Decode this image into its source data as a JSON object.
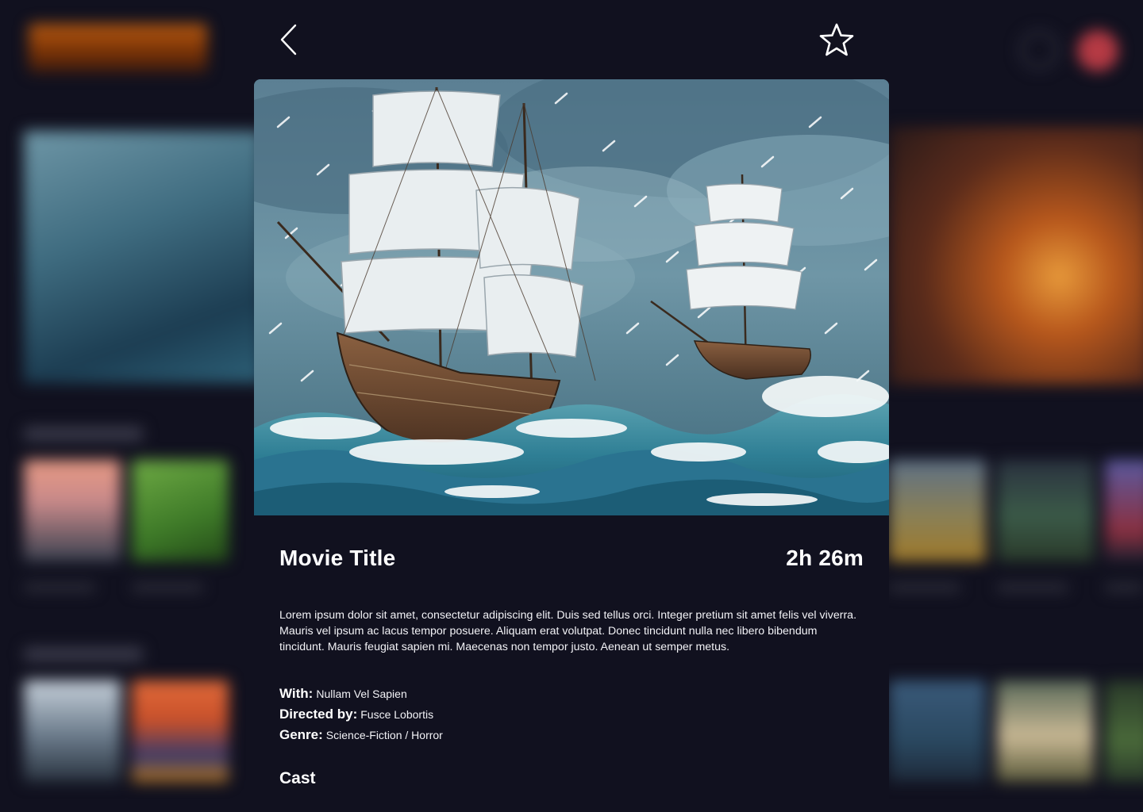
{
  "modal": {
    "title": "Movie Title",
    "runtime": "2h 26m",
    "description": "Lorem ipsum dolor sit amet, consectetur adipiscing elit. Duis sed tellus  orci. Integer pretium sit amet felis vel viverra. Mauris vel ipsum ac  lacus tempor posuere. Aliquam erat volutpat. Donec tincidunt nulla nec  libero bibendum tincidunt. Mauris feugiat sapien mi. Maecenas non tempor  justo. Aenean ut semper metus.",
    "credits": {
      "with_label": "With:",
      "with_value": "Nullam Vel Sapien",
      "directed_label": "Directed by:",
      "directed_value": "Fusce Lobortis",
      "genre_label": "Genre:",
      "genre_value": "Science-Fiction / Horror"
    },
    "cast_heading": "Cast",
    "icons": {
      "back": "chevron-left-icon",
      "favorite": "star-outline-icon"
    }
  },
  "colors": {
    "background": "#11111f",
    "text": "#ffffff"
  }
}
